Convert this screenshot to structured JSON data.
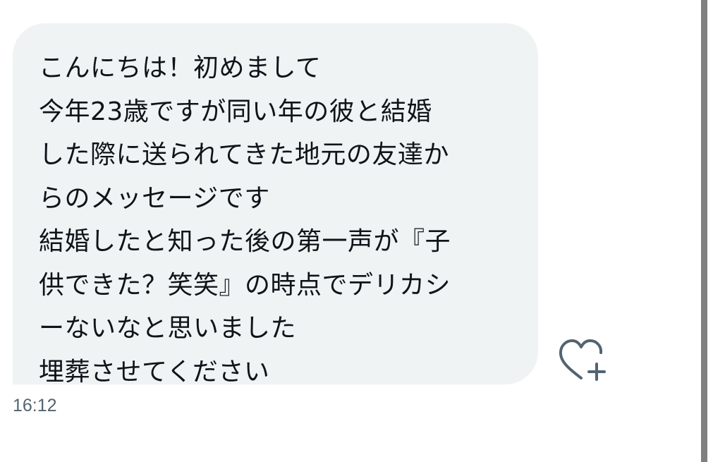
{
  "message": {
    "lines": [
      "こんにちは！初めまして",
      "今年23歳ですが同い年の彼と結婚",
      "した際に送られてきた地元の友達か",
      "らのメッセージです",
      "結婚したと知った後の第一声が『子",
      "供できた？笑笑』の時点でデリカシ",
      "ーないなと思いました",
      "埋葬させてください"
    ],
    "timestamp": "16:12",
    "react_icon": "heart-plus-icon"
  },
  "colors": {
    "bubble": "#eff3f4",
    "text": "#0f1419",
    "secondary": "#536471",
    "scrollbar": "#808080"
  }
}
